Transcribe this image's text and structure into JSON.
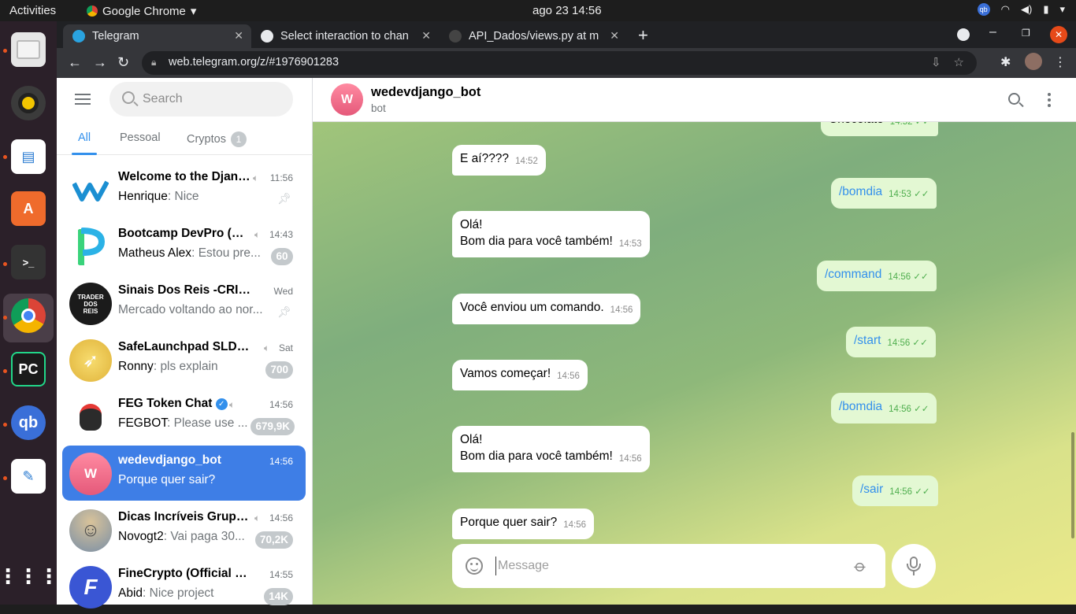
{
  "system": {
    "activities": "Activities",
    "app_name": "Google Chrome",
    "clock": "ago 23  14:56"
  },
  "browser": {
    "tabs": [
      {
        "label": "Telegram",
        "active": true
      },
      {
        "label": "Select interaction to chan",
        "active": false
      },
      {
        "label": "API_Dados/views.py at m",
        "active": false
      }
    ],
    "url": "web.telegram.org/z/#1976901283"
  },
  "sidebar": {
    "search_placeholder": "Search",
    "folders": [
      {
        "label": "All",
        "active": true
      },
      {
        "label": "Pessoal",
        "active": false
      },
      {
        "label": "Cryptos",
        "badge": "1",
        "active": false
      }
    ],
    "chats": [
      {
        "name": "Welcome to the Django",
        "time": "11:56",
        "sender": "Henrique",
        "message": "Nice",
        "pinned": true,
        "muted": true,
        "badge": "",
        "avatar_color": "#ffffff"
      },
      {
        "name": "Bootcamp DevPro (Gr...",
        "time": "14:43",
        "sender": "Matheus Alex",
        "message": "Estou pre...",
        "muted": true,
        "badge": "60",
        "avatar_color": "#ffffff"
      },
      {
        "name": "Sinais Dos Reis -CRIPT...",
        "time": "Wed",
        "sender": "",
        "message": "Mercado voltando ao nor...",
        "pinned": true,
        "badge": "",
        "avatar_color": "#1b1b1b",
        "avatar_text": "TRADER DOS REIS"
      },
      {
        "name": "SafeLaunchpad SLD & ...",
        "time": "Sat",
        "sender": "Ronny",
        "message": "pls explain",
        "muted": true,
        "badge": "700",
        "avatar_color": "#f4d35e"
      },
      {
        "name": "FEG Token Chat",
        "time": "14:56",
        "sender": "FEGBOT",
        "message": "Please use ...",
        "muted": true,
        "verified": true,
        "badge": "679,9K",
        "avatar_color": "#ffffff"
      },
      {
        "name": "wedevdjango_bot",
        "time": "14:56",
        "sender": "",
        "message": "Porque quer sair?",
        "badge": "",
        "selected": true,
        "avatar_text": "W"
      },
      {
        "name": "Dicas Incríveis Grupo...",
        "time": "14:56",
        "sender": "Novogt2",
        "message": "Vai paga 30...",
        "muted": true,
        "badge": "70,2K",
        "avatar_color": "#8fa3b8"
      },
      {
        "name": "FineCrypto (Official C...",
        "time": "14:55",
        "sender": "Abid",
        "message": "Nice project",
        "badge": "14K",
        "avatar_color": "#3a56d4",
        "avatar_text": "F"
      }
    ]
  },
  "chat": {
    "title": "wedevdjango_bot",
    "subtitle": "bot",
    "avatar_letter": "W",
    "messages": [
      {
        "dir": "out",
        "lines": [
          "Chocolate"
        ],
        "time": "14:52"
      },
      {
        "dir": "in",
        "lines": [
          "E aí????"
        ],
        "time": "14:52"
      },
      {
        "dir": "out",
        "lines": [
          "/bomdia"
        ],
        "time": "14:53"
      },
      {
        "dir": "in",
        "lines": [
          "Olá!",
          "Bom dia para você também!"
        ],
        "time": "14:53"
      },
      {
        "dir": "out",
        "lines": [
          "/command"
        ],
        "time": "14:56"
      },
      {
        "dir": "in",
        "lines": [
          "Você enviou um comando."
        ],
        "time": "14:56"
      },
      {
        "dir": "out",
        "lines": [
          "/start"
        ],
        "time": "14:56"
      },
      {
        "dir": "in",
        "lines": [
          "Vamos começar!"
        ],
        "time": "14:56"
      },
      {
        "dir": "out",
        "lines": [
          "/bomdia"
        ],
        "time": "14:56"
      },
      {
        "dir": "in",
        "lines": [
          "Olá!",
          "Bom dia para você também!"
        ],
        "time": "14:56"
      },
      {
        "dir": "out",
        "lines": [
          "/sair"
        ],
        "time": "14:56"
      },
      {
        "dir": "in",
        "lines": [
          "Porque quer sair?"
        ],
        "time": "14:56"
      }
    ],
    "composer_placeholder": "Message"
  },
  "colors": {
    "accent": "#3390ec",
    "selected_chat": "#3e7ee6",
    "outgoing_bubble": "#e3f8d3",
    "read_check": "#4fae4e"
  }
}
